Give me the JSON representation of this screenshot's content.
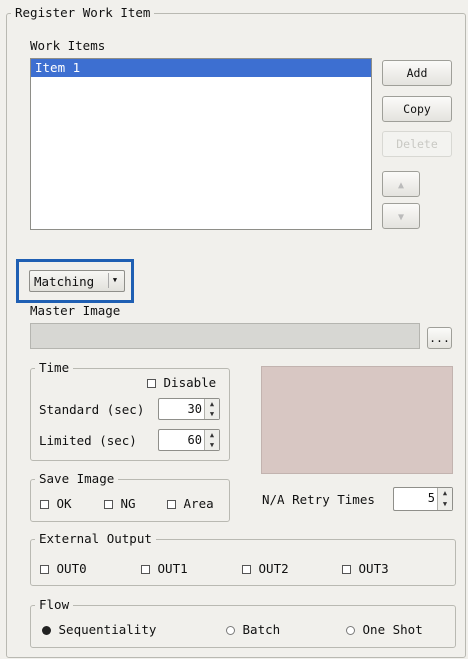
{
  "group_title": "Register Work Item",
  "work_items": {
    "label": "Work Items",
    "items": [
      "Item 1"
    ],
    "selected_index": 0
  },
  "buttons": {
    "add": "Add",
    "copy": "Copy",
    "delete": "Delete"
  },
  "mode_select": {
    "value": "Matching"
  },
  "master_image": {
    "label": "Master Image",
    "path": "",
    "browse": "..."
  },
  "time": {
    "title": "Time",
    "disable_label": "Disable",
    "standard_label": "Standard (sec)",
    "standard_value": "30",
    "limited_label": "Limited (sec)",
    "limited_value": "60"
  },
  "save_image": {
    "title": "Save Image",
    "options": [
      "OK",
      "NG",
      "Area"
    ]
  },
  "na_retry": {
    "label": "N/A Retry Times",
    "value": "5"
  },
  "external_output": {
    "title": "External Output",
    "outputs": [
      "OUT0",
      "OUT1",
      "OUT2",
      "OUT3"
    ]
  },
  "flow": {
    "title": "Flow",
    "options": [
      "Sequentiality",
      "Batch",
      "One Shot"
    ],
    "selected": "Sequentiality"
  },
  "colors": {
    "selection": "#3d6fd1",
    "highlight_box": "#1f5fb3",
    "preview": "#d8c7c3"
  }
}
